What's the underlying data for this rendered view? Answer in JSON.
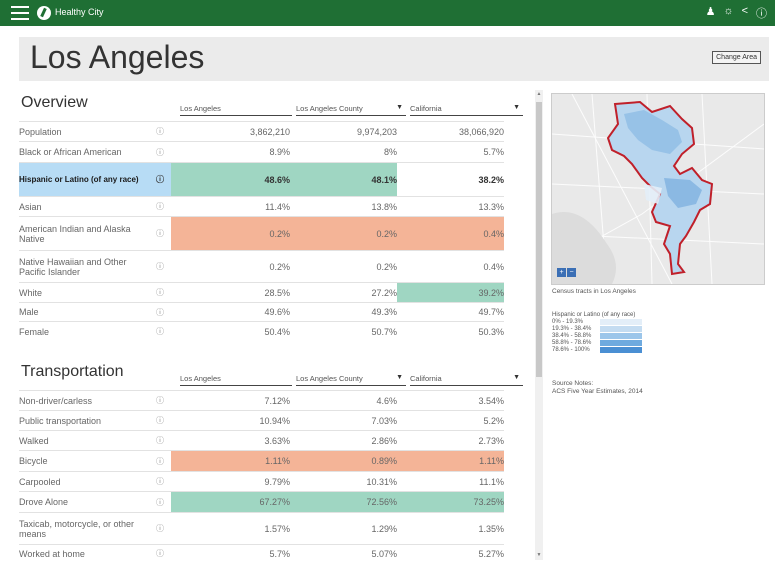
{
  "header": {
    "brand": "Healthy City"
  },
  "page": {
    "title": "Los Angeles",
    "change_area": "Change Area"
  },
  "columns": {
    "c1": "Los Angeles",
    "c2": "Los Angeles County",
    "c3": "California"
  },
  "overview": {
    "title": "Overview",
    "rows": [
      {
        "label": "Population",
        "v1": "3,862,210",
        "v2": "9,974,203",
        "v3": "38,066,920"
      },
      {
        "label": "Black or African American",
        "v1": "8.9%",
        "v2": "8%",
        "v3": "5.7%"
      },
      {
        "label": "Hispanic or Latino (of any race)",
        "v1": "48.6%",
        "v2": "48.1%",
        "v3": "38.2%"
      },
      {
        "label": "Asian",
        "v1": "11.4%",
        "v2": "13.8%",
        "v3": "13.3%"
      },
      {
        "label": "American Indian and Alaska Native",
        "v1": "0.2%",
        "v2": "0.2%",
        "v3": "0.4%"
      },
      {
        "label": "Native Hawaiian and Other Pacific Islander",
        "v1": "0.2%",
        "v2": "0.2%",
        "v3": "0.4%"
      },
      {
        "label": "White",
        "v1": "28.5%",
        "v2": "27.2%",
        "v3": "39.2%"
      },
      {
        "label": "Male",
        "v1": "49.6%",
        "v2": "49.3%",
        "v3": "49.7%"
      },
      {
        "label": "Female",
        "v1": "50.4%",
        "v2": "50.7%",
        "v3": "50.3%"
      }
    ]
  },
  "transportation": {
    "title": "Transportation",
    "rows": [
      {
        "label": "Non-driver/carless",
        "v1": "7.12%",
        "v2": "4.6%",
        "v3": "3.54%"
      },
      {
        "label": "Public transportation",
        "v1": "10.94%",
        "v2": "7.03%",
        "v3": "5.2%"
      },
      {
        "label": "Walked",
        "v1": "3.63%",
        "v2": "2.86%",
        "v3": "2.73%"
      },
      {
        "label": "Bicycle",
        "v1": "1.11%",
        "v2": "0.89%",
        "v3": "1.11%"
      },
      {
        "label": "Carpooled",
        "v1": "9.79%",
        "v2": "10.31%",
        "v3": "11.1%"
      },
      {
        "label": "Drove Alone",
        "v1": "67.27%",
        "v2": "72.56%",
        "v3": "73.25%"
      },
      {
        "label": "Taxicab, motorcycle, or other means",
        "v1": "1.57%",
        "v2": "1.29%",
        "v3": "1.35%"
      },
      {
        "label": "Worked at home",
        "v1": "5.7%",
        "v2": "5.07%",
        "v3": "5.27%"
      }
    ]
  },
  "map": {
    "caption": "Census tracts in Los Angeles",
    "legend_title": "Hispanic or Latino (of any race)",
    "legend": [
      {
        "range": "0% - 19.3%",
        "color": "#e3eef8"
      },
      {
        "range": "19.3% - 38.4%",
        "color": "#c4dcf1"
      },
      {
        "range": "38.4% - 58.8%",
        "color": "#9cc6ea"
      },
      {
        "range": "58.8% - 78.6%",
        "color": "#6eaadf"
      },
      {
        "range": "78.6% - 100%",
        "color": "#4a8fd3"
      }
    ],
    "source_label": "Source Notes:",
    "source_text": "ACS Five Year Estimates, 2014"
  }
}
